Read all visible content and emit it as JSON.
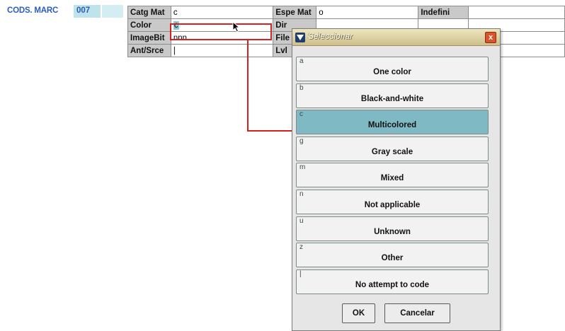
{
  "marc": {
    "label": "CODS. MARC",
    "tag": "007"
  },
  "grid": {
    "rows": [
      [
        {
          "label": "Catg Mat",
          "value": "c"
        },
        {
          "label": "Espe Mat",
          "value": "o"
        },
        {
          "label": "Indefini",
          "value": ""
        }
      ],
      [
        {
          "label": "Color",
          "value": "c"
        },
        {
          "label": "Dir",
          "value": ""
        }
      ],
      [
        {
          "label": "ImageBit",
          "value": "nnn"
        },
        {
          "label": "File",
          "value": ""
        }
      ],
      [
        {
          "label": "Ant/Srce",
          "value": "|"
        },
        {
          "label": "Lvl",
          "value": ""
        }
      ]
    ]
  },
  "dialog": {
    "title": "Seleccionar",
    "close": "x",
    "options": [
      {
        "code": "a",
        "label": "One color"
      },
      {
        "code": "b",
        "label": "Black-and-white"
      },
      {
        "code": "c",
        "label": "Multicolored"
      },
      {
        "code": "g",
        "label": "Gray scale"
      },
      {
        "code": "m",
        "label": "Mixed"
      },
      {
        "code": "n",
        "label": "Not applicable"
      },
      {
        "code": "u",
        "label": "Unknown"
      },
      {
        "code": "z",
        "label": "Other"
      },
      {
        "code": "|",
        "label": "No attempt to code"
      }
    ],
    "selected_code": "c",
    "ok_label": "OK",
    "cancel_label": "Cancelar"
  },
  "colors": {
    "selected": "#7fb9c3",
    "highlight": "#d42020",
    "brand": "#2a5db8"
  }
}
